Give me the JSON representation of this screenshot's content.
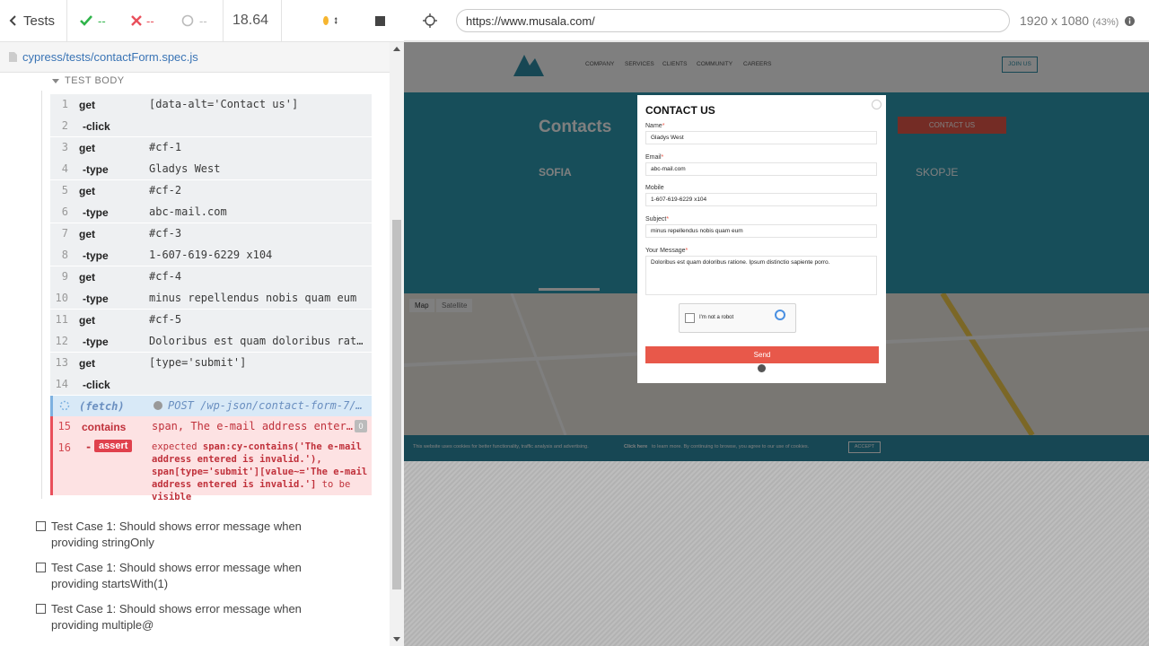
{
  "reporter": {
    "back_label": "Tests",
    "passed": "--",
    "failed": "--",
    "pending": "--",
    "duration": "18.64",
    "spec_file": "cypress/tests/contactForm.spec.js",
    "test_body_label": "TEST BODY",
    "commands": [
      {
        "num": "1",
        "name": "get",
        "message": "[data-alt='Contact us']"
      },
      {
        "num": "2",
        "name": "-click",
        "message": ""
      },
      {
        "num": "3",
        "name": "get",
        "message": "#cf-1"
      },
      {
        "num": "4",
        "name": "-type",
        "message": "Gladys West"
      },
      {
        "num": "5",
        "name": "get",
        "message": "#cf-2"
      },
      {
        "num": "6",
        "name": "-type",
        "message": "abc-mail.com"
      },
      {
        "num": "7",
        "name": "get",
        "message": "#cf-3"
      },
      {
        "num": "8",
        "name": "-type",
        "message": "1-607-619-6229 x104"
      },
      {
        "num": "9",
        "name": "get",
        "message": "#cf-4"
      },
      {
        "num": "10",
        "name": "-type",
        "message": "minus repellendus nobis quam eum"
      },
      {
        "num": "11",
        "name": "get",
        "message": "#cf-5"
      },
      {
        "num": "12",
        "name": "-type",
        "message": "Doloribus est quam doloribus rat…"
      },
      {
        "num": "13",
        "name": "get",
        "message": "[type='submit']"
      },
      {
        "num": "14",
        "name": "-click",
        "message": ""
      }
    ],
    "fetch": {
      "name": "(fetch)",
      "message": "POST /wp-json/contact-form-7/…"
    },
    "error_cmd": {
      "num": "15",
      "name": "contains",
      "message": "span, The e-mail address enter…",
      "badge": "0"
    },
    "assert_cmd": {
      "num": "16",
      "name": "-",
      "badge": "assert",
      "expected": "expected",
      "selector": "span:cy-contains('The e-mail address entered is invalid.'), span[type='submit'][value~='The e-mail address entered is invalid.']",
      "to_be": "to be",
      "visible": "visible"
    },
    "test_cases": [
      "Test Case 1: Should shows error message when providing stringOnly",
      "Test Case 1: Should shows error message when providing startsWith(1)",
      "Test Case 1: Should shows error message when providing multiple@"
    ]
  },
  "aut": {
    "url": "https://www.musala.com/",
    "viewport": "1920 x 1080",
    "scale": "(43%)",
    "site": {
      "nav_links": [
        "COMPANY",
        "SERVICES",
        "CLIENTS",
        "COMMUNITY",
        "CAREERS"
      ],
      "join_us": "JOIN US",
      "contacts_heading": "Contacts",
      "contact_us_button": "CONTACT US",
      "city_left": "SOFIA",
      "city_right": "SKOPJE",
      "map_tab": "Map",
      "satellite_tab": "Satellite",
      "cookie_text": "This website uses cookies for better functionality, traffic analysis and advertising.",
      "cookie_link": "Click here",
      "cookie_rest": "to learn more. By continuing to browse, you agree to our use of cookies.",
      "accept": "ACCEPT"
    },
    "modal": {
      "title": "CONTACT US",
      "name_label": "Name",
      "name_value": "Gladys West",
      "email_label": "Email",
      "email_value": "abc-mail.com",
      "mobile_label": "Mobile",
      "mobile_value": "1-607-619-6229 x104",
      "subject_label": "Subject",
      "subject_value": "minus repellendus nobis quam eum",
      "message_label": "Your Message",
      "message_value": "Doloribus est quam doloribus ratione. Ipsum distinctio sapiente porro.",
      "captcha_label": "I'm not a robot",
      "send_label": "Send",
      "required_mark": "*"
    }
  },
  "colors": {
    "pass": "#2fb44a",
    "fail": "#e94f5b",
    "error_bg": "#fde2e3",
    "send": "#e8584a",
    "hero": "#2f9db4"
  }
}
